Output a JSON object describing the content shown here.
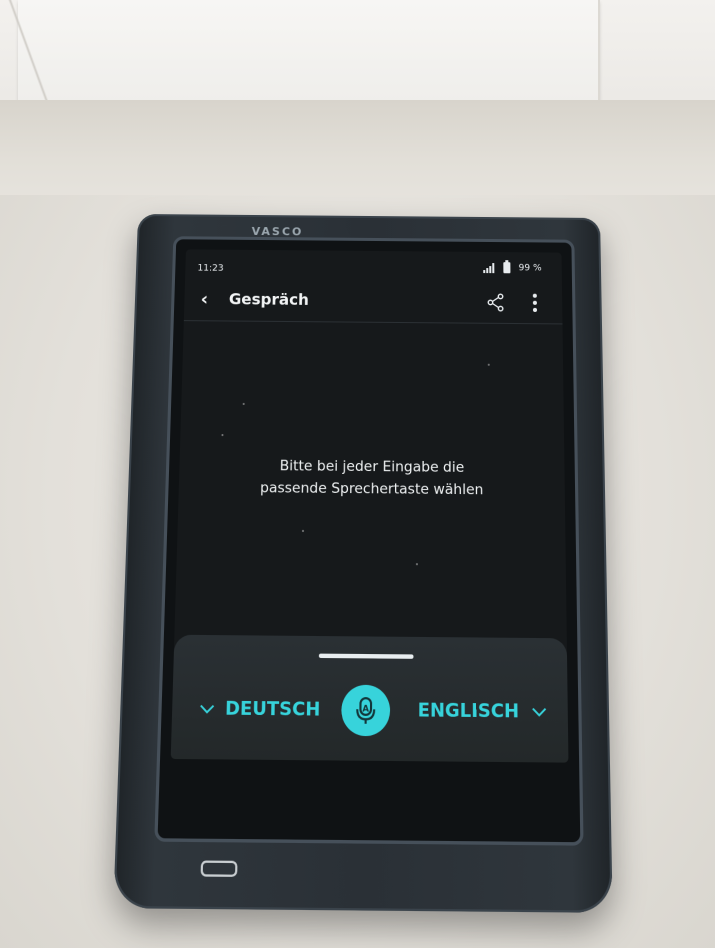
{
  "device": {
    "brand": "VASCO"
  },
  "status_bar": {
    "time": "11:23",
    "battery": "99 %"
  },
  "app_bar": {
    "back_icon": "chevron-left-icon",
    "title": "Gespräch",
    "share_icon": "share-icon",
    "more_icon": "more-vertical-icon"
  },
  "main": {
    "hint_line1": "Bitte bei jeder Eingabe die",
    "hint_line2": "passende Sprechertaste wählen"
  },
  "language_bar": {
    "left_language": "DEUTSCH",
    "right_language": "ENGLISCH",
    "mic_icon": "microphone-icon",
    "accent_color": "#37d3db"
  }
}
